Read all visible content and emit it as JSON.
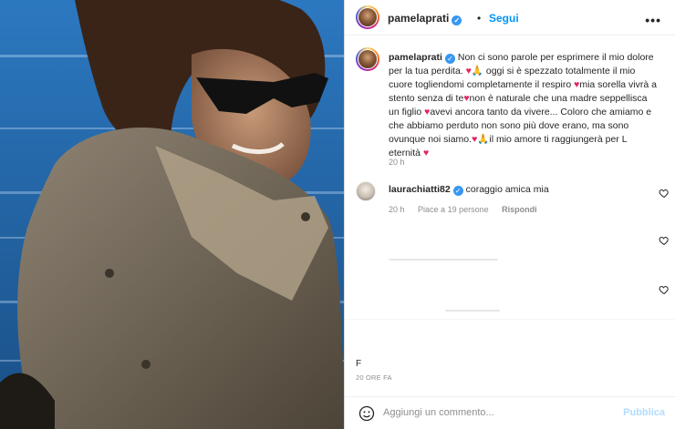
{
  "post": {
    "author": "pamelaprati",
    "follow_label": "Segui",
    "more_label": "•••",
    "separator": "•"
  },
  "caption": {
    "author": "pamelaprati",
    "p1": "Non ci sono parole per esprimere il mio dolore per la tua perdita. ",
    "p2": " oggi si è spezzato totalmente il mio cuore togliendomi completamente il respiro ",
    "p3": "mia sorella vivrà a stento senza di te",
    "p4": "non è naturale che una madre seppellisca un figlio ",
    "p5": "avevi ancora tanto da vivere... Coloro che amiamo e che abbiamo perduto non sono più dove erano, ma sono ovunque noi siamo.",
    "p6": "il mio amore ti raggiungerà per L eternità ",
    "time": "20 h"
  },
  "comments": [
    {
      "author": "laurachiatti82",
      "text": "coraggio amica mia",
      "time": "20 h",
      "likes": "Piace a 19 persone",
      "reply": "Rispondi"
    }
  ],
  "footer": {
    "date": "20 ORE FA",
    "stray_char": "F",
    "comment_placeholder": "Aggiungi un commento...",
    "publish_label": "Pubblica"
  },
  "colors": {
    "accent": "#0095f6",
    "verified": "#3897f0",
    "heart": "#e0245e",
    "muted": "#8e8e8e"
  },
  "icons": [
    "verified-badge-icon",
    "more-options-icon",
    "red-heart-emoji",
    "praying-hands-emoji",
    "like-heart-icon",
    "emoji-icon"
  ]
}
